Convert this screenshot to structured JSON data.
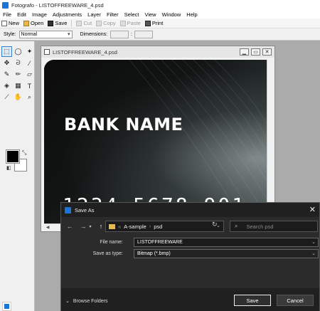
{
  "app": {
    "title": "Fotografo - LISTOFFREEWARE_4.psd"
  },
  "menu": [
    "File",
    "Edit",
    "Image",
    "Adjustments",
    "Layer",
    "Filter",
    "Select",
    "View",
    "Window",
    "Help"
  ],
  "toolbar": {
    "new": "New",
    "open": "Open",
    "save": "Save",
    "cut": "Cut",
    "copy": "Copy",
    "paste": "Paste",
    "print": "Print"
  },
  "options": {
    "style_label": "Style:",
    "style_value": "Normal",
    "dimensions_label": "Dimensions:",
    "dim_sep": ":"
  },
  "tools": [
    {
      "name": "rect-select-tool",
      "glyph": "⬚"
    },
    {
      "name": "ellipse-select-tool",
      "glyph": "◯"
    },
    {
      "name": "magic-wand-tool",
      "glyph": "✦"
    },
    {
      "name": "move-tool",
      "glyph": "✥"
    },
    {
      "name": "lasso-tool",
      "glyph": "ᘐ"
    },
    {
      "name": "eyedropper-tool",
      "glyph": "⁄"
    },
    {
      "name": "brush-tool",
      "glyph": "✎"
    },
    {
      "name": "pencil-tool",
      "glyph": "✏"
    },
    {
      "name": "eraser-tool",
      "glyph": "▱"
    },
    {
      "name": "fill-tool",
      "glyph": "◈"
    },
    {
      "name": "gradient-tool",
      "glyph": "▦"
    },
    {
      "name": "text-tool",
      "glyph": "T"
    },
    {
      "name": "color-picker-tool",
      "glyph": "⟋"
    },
    {
      "name": "hand-tool",
      "glyph": "✋"
    },
    {
      "name": "zoom-tool",
      "glyph": "⌕"
    }
  ],
  "document": {
    "title": "LISTOFFREEWARE_4.psd",
    "bank_name": "BANK NAME",
    "card_number": "1234 5678 901"
  },
  "dialog": {
    "title": "Save As",
    "path": {
      "prefix": "«",
      "folder": "A-sample",
      "sub": "psd"
    },
    "search_placeholder": "Search psd",
    "file_name_label": "File name:",
    "file_name_value": "LISTOFFREEWARE",
    "save_type_label": "Save as type:",
    "save_type_value": "Bitmap (*.bmp)",
    "browse_label": "Browse Folders",
    "save_button": "Save",
    "cancel_button": "Cancel"
  }
}
